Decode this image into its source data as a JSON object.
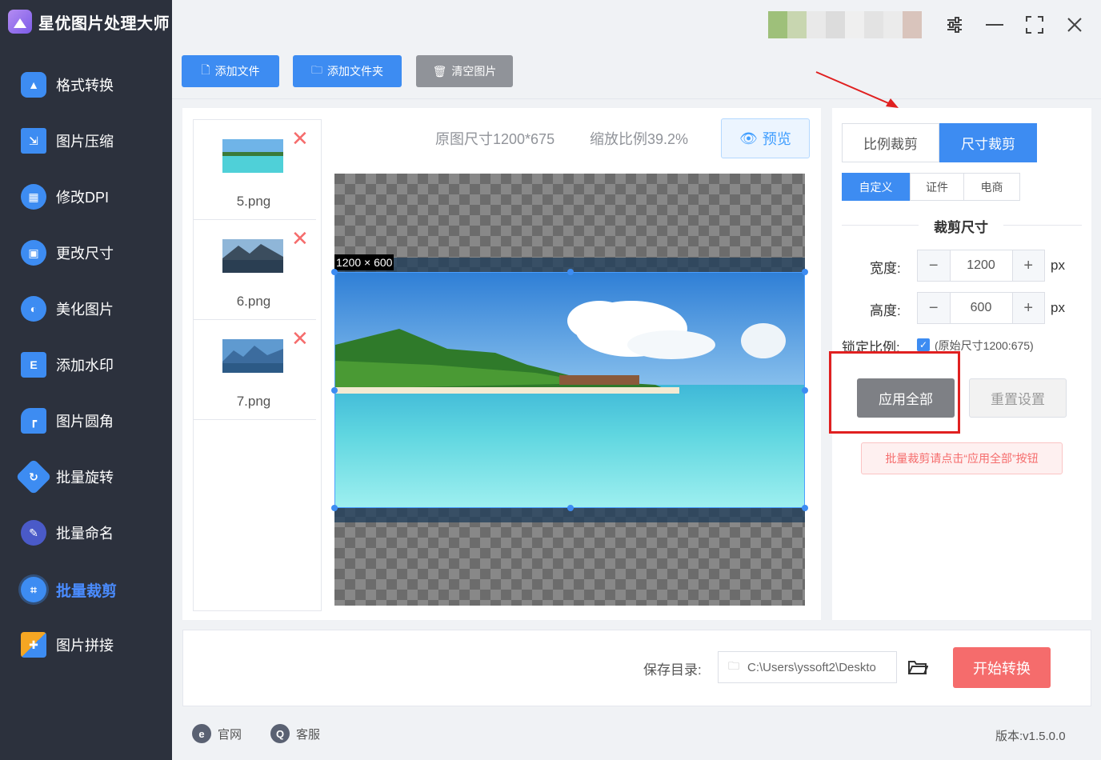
{
  "app": {
    "title": "星优图片处理大师"
  },
  "sidebar": {
    "items": [
      {
        "label": "格式转换",
        "icon": "image-convert-icon",
        "color": "#3d8cf2"
      },
      {
        "label": "图片压缩",
        "icon": "compress-icon",
        "color": "#3d8cf2"
      },
      {
        "label": "修改DPI",
        "icon": "dpi-icon",
        "color": "#3d8cf2"
      },
      {
        "label": "更改尺寸",
        "icon": "resize-icon",
        "color": "#3d8cf2"
      },
      {
        "label": "美化图片",
        "icon": "beautify-icon",
        "color": "#3d8cf2"
      },
      {
        "label": "添加水印",
        "icon": "watermark-icon",
        "color": "#3d8cf2"
      },
      {
        "label": "图片圆角",
        "icon": "rounded-corner-icon",
        "color": "#3d8cf2"
      },
      {
        "label": "批量旋转",
        "icon": "rotate-icon",
        "color": "#3d8cf2"
      },
      {
        "label": "批量命名",
        "icon": "rename-icon",
        "color": "#4a5ac8"
      },
      {
        "label": "批量裁剪",
        "icon": "crop-icon",
        "color": "#3d8cf2",
        "active": true
      },
      {
        "label": "图片拼接",
        "icon": "puzzle-icon",
        "color": "#f5a623"
      }
    ]
  },
  "toolbar": {
    "add_file": "添加文件",
    "add_folder": "添加文件夹",
    "clear": "清空图片"
  },
  "files": [
    {
      "name": "5.png"
    },
    {
      "name": "6.png"
    },
    {
      "name": "7.png"
    }
  ],
  "preview": {
    "original_size": "原图尺寸1200*675",
    "scale": "缩放比例39.2%",
    "preview_button": "预览",
    "crop_label": "1200 × 600"
  },
  "crop": {
    "mode_tabs": [
      "比例裁剪",
      "尺寸裁剪"
    ],
    "active_mode": "尺寸裁剪",
    "preset_tabs": [
      "自定义",
      "证件",
      "电商"
    ],
    "active_preset": "自定义",
    "section_title": "裁剪尺寸",
    "width_label": "宽度:",
    "width_value": "1200",
    "height_label": "高度:",
    "height_value": "600",
    "unit": "px",
    "lock_label": "锁定比例:",
    "lock_checked": true,
    "lock_hint": "(原始尺寸1200:675)",
    "apply_all": "应用全部",
    "reset": "重置设置",
    "tip": "批量裁剪请点击“应用全部”按钮"
  },
  "output": {
    "save_label": "保存目录:",
    "save_path": "C:\\Users\\yssoft2\\Deskto",
    "start_button": "开始转换"
  },
  "footer": {
    "website": "官网",
    "support": "客服",
    "version": "版本:v1.5.0.0"
  },
  "colors": {
    "accent": "#3d8cf2",
    "danger": "#f56c6c",
    "highlight_box": "#e02020",
    "sidebar_bg": "#2c313d"
  }
}
